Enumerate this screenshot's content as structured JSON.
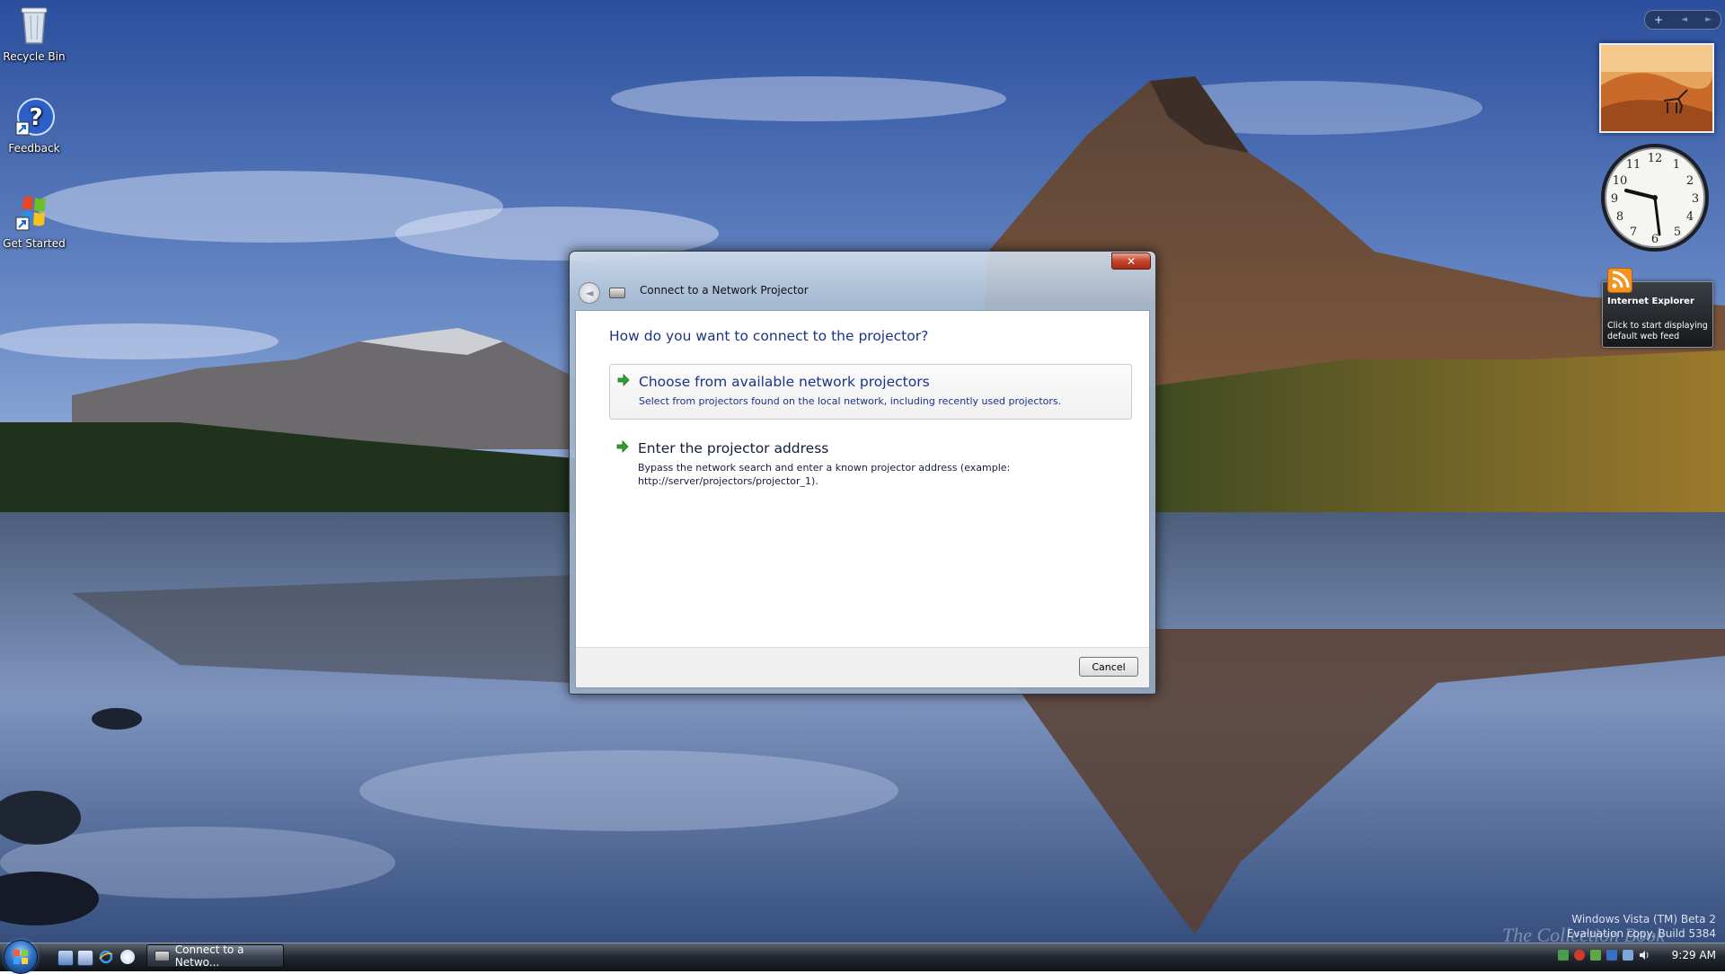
{
  "desktop": {
    "icons": [
      {
        "label": "Recycle Bin"
      },
      {
        "label": "Feedback"
      },
      {
        "label": "Get Started"
      }
    ]
  },
  "sidebar": {
    "controls": {
      "add": "+",
      "prev": "◄",
      "next": "►"
    },
    "feed_gadget": {
      "title": "Internet Explorer",
      "description": "Click to start displaying default web feed"
    }
  },
  "dialog": {
    "title": "Connect to a Network Projector",
    "close_glyph": "✕",
    "back_glyph": "◄",
    "heading": "How do you want to connect to the projector?",
    "options": [
      {
        "title": "Choose from available network projectors",
        "description": "Select from projectors found on the local network, including recently used projectors."
      },
      {
        "title": "Enter the projector address",
        "description": "Bypass the network search and enter a known projector address (example: http://server/projectors/projector_1)."
      }
    ],
    "cancel_label": "Cancel"
  },
  "taskbar": {
    "task_button_label": "Connect to a Netwo...",
    "clock": "9:29 AM"
  },
  "watermark": {
    "line1": "Windows Vista (TM) Beta 2",
    "line2": "Evaluation copy. Build 5384",
    "book": "The Collection Book"
  },
  "colors": {
    "link_blue": "#1e3287",
    "arrow_green": "#2ea12e",
    "close_red": "#c7442c"
  }
}
